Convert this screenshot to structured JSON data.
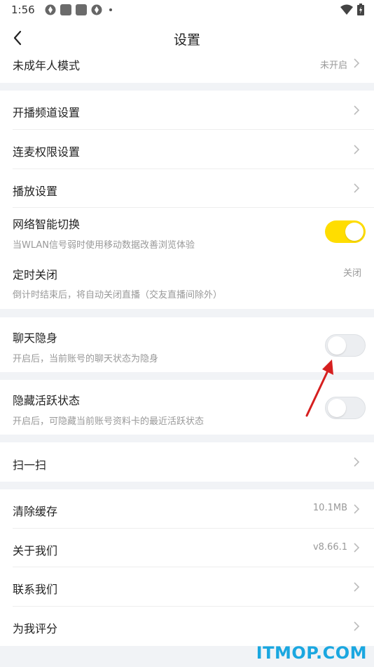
{
  "status": {
    "time": "1:56"
  },
  "header": {
    "title": "设置"
  },
  "items": {
    "minor_mode": {
      "label": "未成年人模式",
      "value": "未开启"
    },
    "channel": {
      "label": "开播频道设置"
    },
    "connect_mic": {
      "label": "连麦权限设置"
    },
    "playback": {
      "label": "播放设置"
    },
    "network": {
      "label": "网络智能切换",
      "sub": "当WLAN信号弱时使用移动数据改善浏览体验",
      "enabled": true
    },
    "timer": {
      "label": "定时关闭",
      "value": "关闭",
      "sub": "倒计时结束后，将自动关闭直播（交友直播间除外）"
    },
    "chat_invisible": {
      "label": "聊天隐身",
      "sub": "开启后，当前账号的聊天状态为隐身",
      "enabled": false
    },
    "hide_active": {
      "label": "隐藏活跃状态",
      "sub": "开启后，可隐藏当前账号资料卡的最近活跃状态",
      "enabled": false
    },
    "scan": {
      "label": "扫一扫"
    },
    "clear_cache": {
      "label": "清除缓存",
      "value": "10.1MB"
    },
    "about": {
      "label": "关于我们",
      "value": "v8.66.1"
    },
    "contact": {
      "label": "联系我们"
    },
    "rate": {
      "label": "为我评分"
    }
  },
  "watermark": "ITMOP.COM",
  "colors": {
    "accent": "#ffdd00",
    "arrow": "#d61f1f",
    "watermark": "#1aa7e0"
  }
}
